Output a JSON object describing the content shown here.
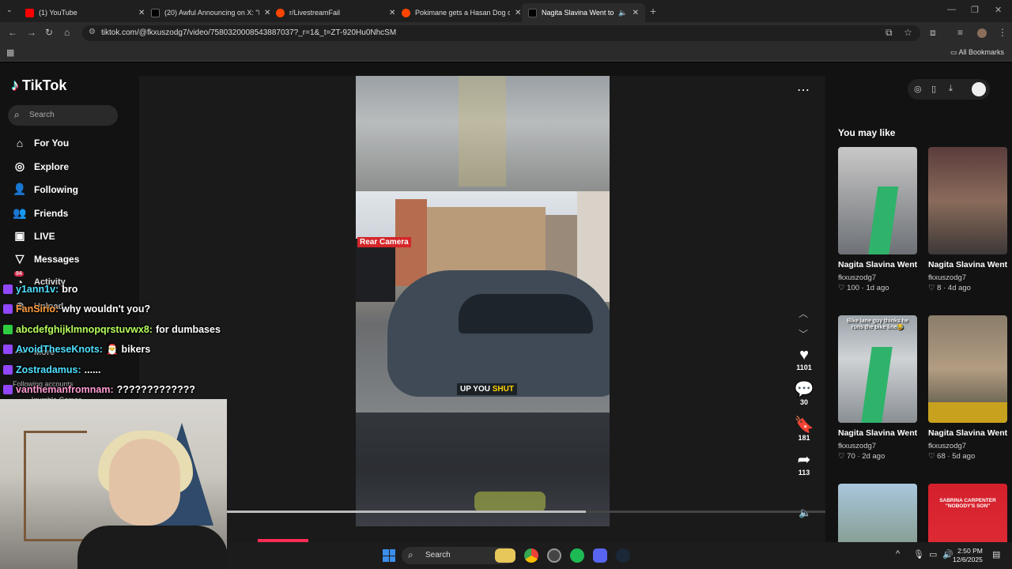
{
  "browser": {
    "tabs": [
      {
        "title": "(1) YouTube",
        "color": "#ff0000"
      },
      {
        "title": "(20) Awful Announcing on X: \"I",
        "color": "#000000"
      },
      {
        "title": "r/LivestreamFail",
        "color": "#ff4500"
      },
      {
        "title": "Pokimane gets a Hasan Dog cli",
        "color": "#ff4500"
      },
      {
        "title": "Nagita Slavina Went to Wat",
        "color": "#000000"
      }
    ],
    "url": "tiktok.com/@fkxuszodg7/video/7580320008543887037?_r=1&_t=ZT-920Hu0NhcSM",
    "bookmarks_label": "All Bookmarks"
  },
  "sidebar": {
    "logo": "TikTok",
    "search_placeholder": "Search",
    "items": [
      {
        "label": "For You",
        "icon": "home-icon"
      },
      {
        "label": "Explore",
        "icon": "compass-icon"
      },
      {
        "label": "Following",
        "icon": "following-icon"
      },
      {
        "label": "Friends",
        "icon": "friends-icon"
      },
      {
        "label": "LIVE",
        "icon": "live-icon"
      },
      {
        "label": "Messages",
        "icon": "messages-icon"
      },
      {
        "label": "Activity",
        "icon": "activity-icon"
      },
      {
        "label": "Upload",
        "icon": "upload-icon"
      }
    ],
    "activity_badge": "94",
    "more_label": "More",
    "following_accounts_label": "Following accounts",
    "account_label": "krumble Games"
  },
  "video": {
    "rear_camera_label": "Rear Camera",
    "caption_parts": [
      "UP YOU ",
      "SHUT"
    ],
    "likes": "1101",
    "comments": "30",
    "bookmarks": "181",
    "shares": "113",
    "progress": 0.6
  },
  "recommendations": {
    "heading": "You may like",
    "items": [
      {
        "title": "Nagita Slavina Went to WatchBLACKRIN...",
        "author": "fkxuszodg7",
        "likes": "100",
        "age": "1d ago"
      },
      {
        "title": "Nagita Slavina Went to WatchBLACKRIN...",
        "author": "fkxuszodg7",
        "likes": "8",
        "age": "4d ago"
      },
      {
        "title": "Nagita Slavina Went to WatchBLACKRIN...",
        "author": "fkxuszodg7",
        "likes": "70",
        "age": "2d ago"
      },
      {
        "title": "Nagita Slavina Went to WatchBLACKRIN...",
        "author": "fkxuszodg7",
        "likes": "68",
        "age": "5d ago"
      }
    ],
    "thumb_captions": [
      "Bike lane guy thinks he runs the bike line😂",
      "SABRINA CARPENTER \"NOBODY'S SON\""
    ]
  },
  "chat": [
    {
      "user": "y1ann1v:",
      "message": "bro",
      "color": "#4fe0ff"
    },
    {
      "user": "FanSirio:",
      "message": "why wouldn't you?",
      "color": "#ff9b3d"
    },
    {
      "user": "abcdefghijklmnopqrstuvwx8:",
      "message": "for dumbases",
      "color": "#b6ff5c"
    },
    {
      "user": "AvoidTheseKnots:",
      "message": "bikers",
      "color": "#4fe0ff"
    },
    {
      "user": "Zostradamus:",
      "message": "......",
      "color": "#4fe0ff"
    },
    {
      "user": "vanthemanfromnam:",
      "message": "?????????????",
      "color": "#ff9bd1"
    }
  ],
  "taskbar": {
    "search_placeholder": "Search",
    "time": "2:50 PM",
    "date": "12/6/2025"
  },
  "colors": {
    "tiktok_red": "#fe2c55",
    "accent_green": "#2fb36b"
  }
}
